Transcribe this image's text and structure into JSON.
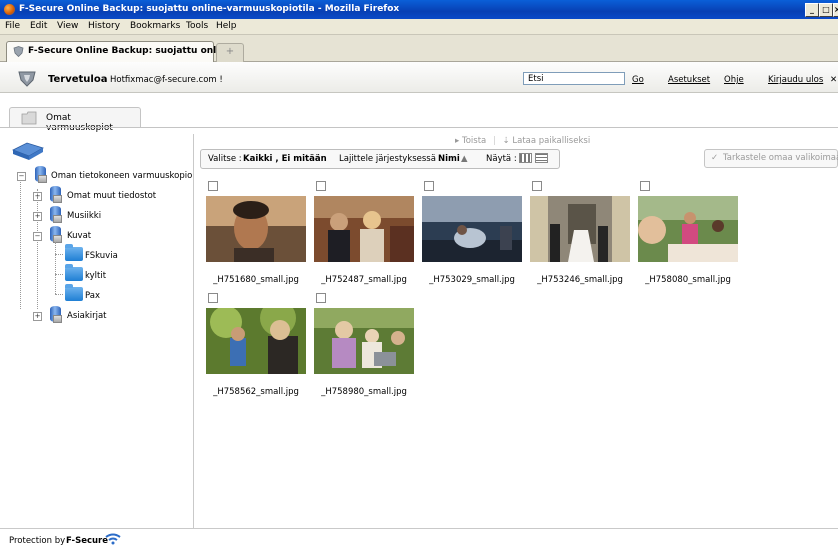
{
  "window": {
    "title": "F-Secure Online Backup: suojattu online-varmuuskopiotila - Mozilla Firefox"
  },
  "menu": [
    "File",
    "Edit",
    "View",
    "History",
    "Bookmarks",
    "Tools",
    "Help"
  ],
  "tab": {
    "title": "F-Secure Online Backup: suojattu onl...",
    "new_tab_symbol": "+"
  },
  "header": {
    "welcome": "Tervetuloa",
    "email": "Hotfixmac@f-secure.com !",
    "search_value": "Etsi",
    "go_label": "Go",
    "links": [
      "Asetukset",
      "Ohje",
      "Kirjaudu ulos"
    ]
  },
  "section_tab": "Omat varmuuskopiot",
  "tree": {
    "root": "Oman tietokoneen varmuuskopio",
    "items": [
      "Omat muut tiedostot",
      "Musiikki",
      "Kuvat",
      "Asiakirjat"
    ],
    "kuvat_children": [
      "FSkuvia",
      "kyltit",
      "Pax"
    ]
  },
  "toolbar": {
    "restore": "Toista",
    "download": "Lataa paikalliseksi",
    "select_prefix": "Valitse :",
    "select_options": "Kaikki , Ei mitään",
    "sort_prefix": "Lajittele järjestyksessä :",
    "sort_value": "Nimi",
    "show_prefix": "Näytä :",
    "view_menu": "Tarkastele omaa valikoimaa"
  },
  "files": [
    "_H751680_small.jpg",
    "_H752487_small.jpg",
    "_H753029_small.jpg",
    "_H753246_small.jpg",
    "_H758080_small.jpg",
    "_H758562_small.jpg",
    "_H758980_small.jpg"
  ],
  "footer": {
    "prefix": "Protection by",
    "brand": "F-Secure"
  }
}
